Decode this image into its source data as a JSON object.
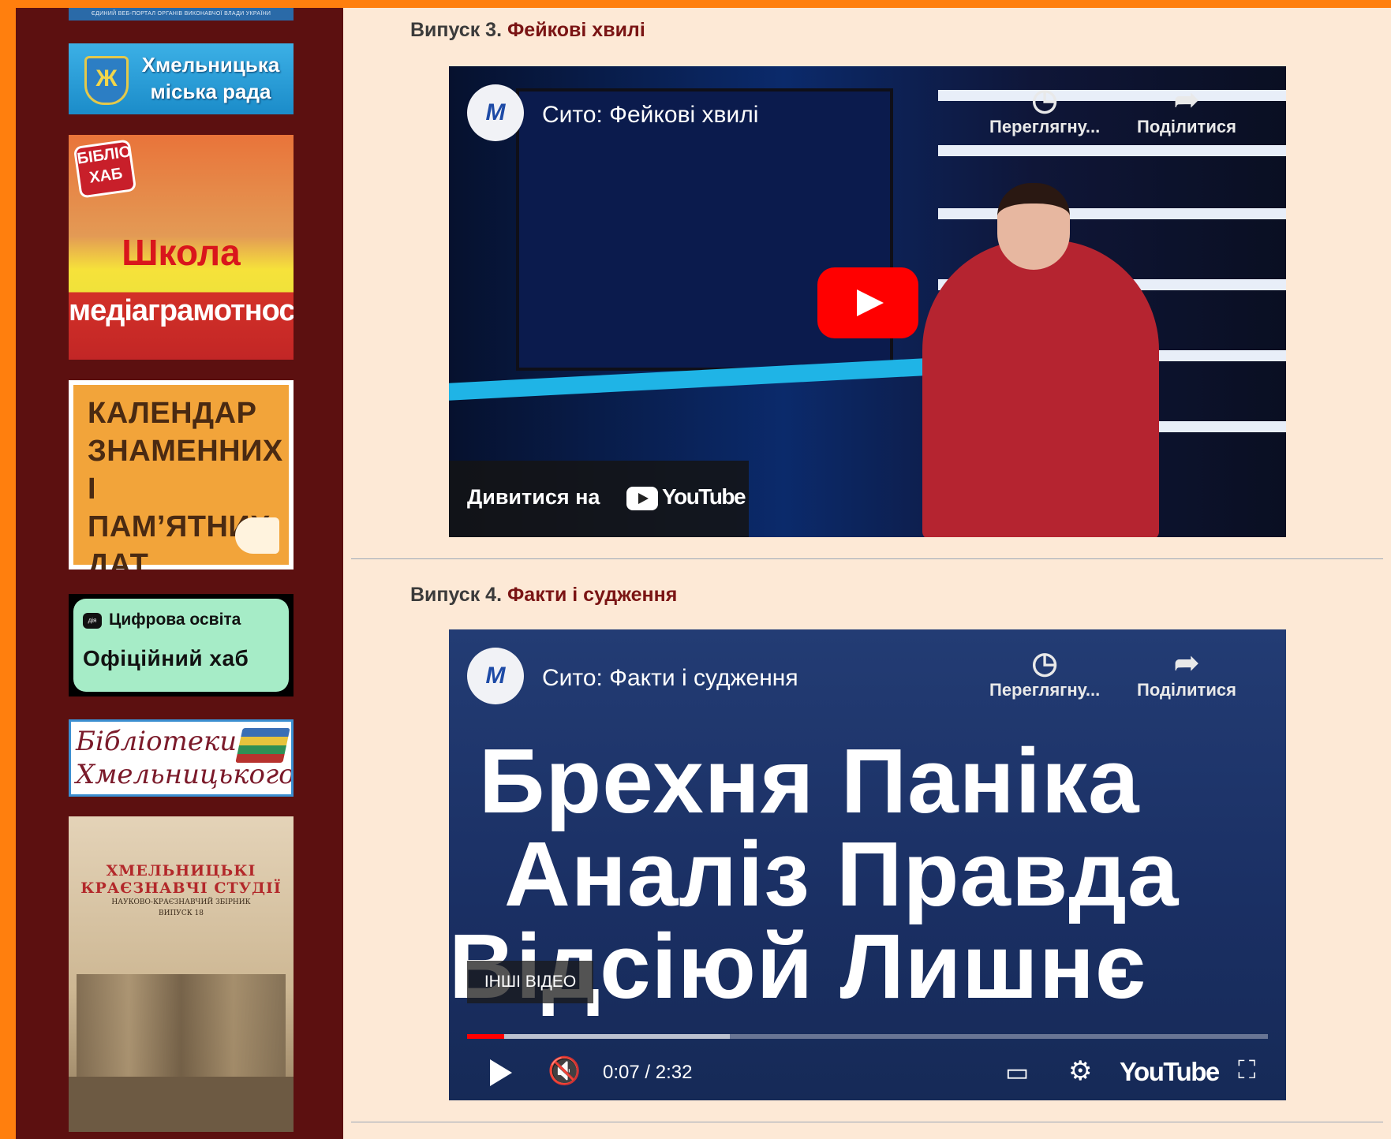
{
  "sidebar": {
    "banners": [
      {
        "name": "portal-banner",
        "text": "ЄДИНИЙ ВЕБ-ПОРТАЛ ОРГАНІВ ВИКОНАВЧОЇ ВЛАДИ УКРАЇНИ"
      },
      {
        "name": "city-council",
        "text": "Хмельницька міська рада"
      },
      {
        "name": "media-literacy-school",
        "badge": "БІБЛІО ХАБ",
        "line1": "Школа",
        "line2": "медіаграмотності"
      },
      {
        "name": "calendar-dates",
        "text": "КАЛЕНДАР ЗНАМЕННИХ І ПАМ’ЯТНИХ ДАТ"
      },
      {
        "name": "digital-education",
        "logo": "дія",
        "line1": "Цифрова освіта",
        "line2": "Офіційний хаб"
      },
      {
        "name": "libraries",
        "line1": "Бібліотеки",
        "line2": "Хмельницького"
      },
      {
        "name": "local-history-book",
        "line1": "ХМЕЛЬНИЦЬКІ",
        "line2": "КРАЄЗНАВЧІ СТУДІЇ",
        "line3": "НАУКОВО-КРАЄЗНАВЧИЙ ЗБІРНИК",
        "line4": "ВИПУСК 18"
      }
    ]
  },
  "main": {
    "episodes": [
      {
        "prefix": "Випуск 3.",
        "title": "Фейкові хвилі",
        "video": {
          "channel_logo": "M",
          "title": "Сито: Фейкові хвилі",
          "watch_later": "Переглягну...",
          "share": "Поділитися",
          "watermark": "M",
          "watch_on": "Дивитися на",
          "youtube": "YouTube"
        }
      },
      {
        "prefix": "Випуск 4.",
        "title": "Факти і судження",
        "video": {
          "channel_logo": "M",
          "title": "Сито: Факти і судження",
          "watch_later": "Переглягну...",
          "share": "Поділитися",
          "watermark": "M",
          "words_line1": "Брехня Паніка",
          "words_line2": "Аналіз Правда",
          "words_line3": "Відсіюй  Лишнє",
          "more_videos": "ІНШІ ВІДЕО",
          "time": "0:07 / 2:32",
          "progress": 0.046,
          "youtube": "YouTube"
        }
      }
    ]
  },
  "colors": {
    "frame": "#ff7f0e",
    "sidebar": "#5c1010",
    "page": "#fde9d6",
    "title_accent": "#7a1414",
    "youtube_red": "#ff0000"
  }
}
